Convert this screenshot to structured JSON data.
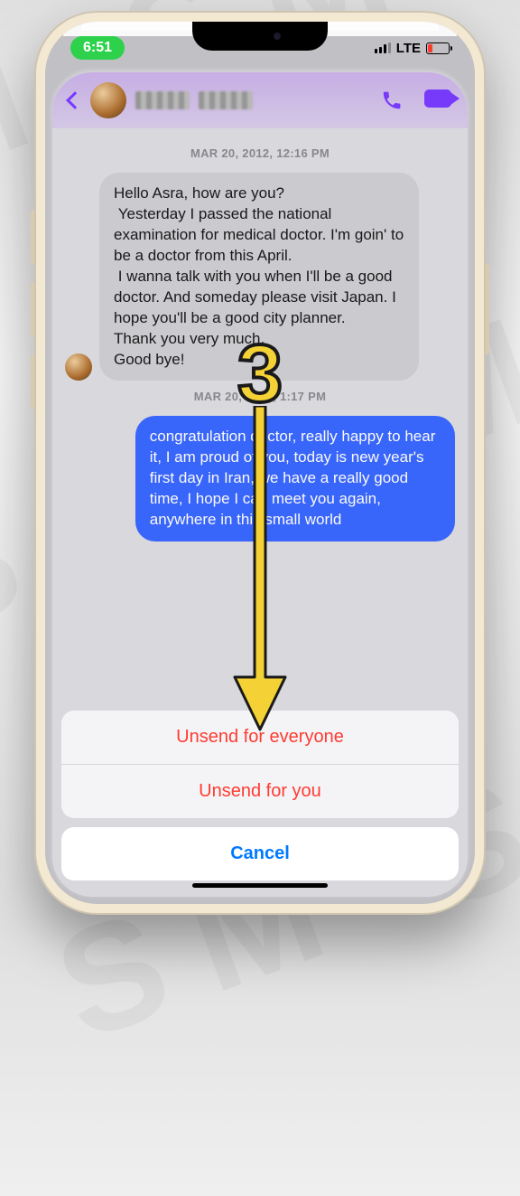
{
  "status": {
    "time": "6:51",
    "network": "LTE"
  },
  "header": {
    "contact_name_obscured": true
  },
  "timestamps": {
    "t1": "MAR 20, 2012, 12:16 PM",
    "t2": "MAR 20, 2012, 1:17 PM"
  },
  "messages": {
    "incoming": "Hello Asra, how are you?\n Yesterday I passed the national examination for medical doctor. I'm goin' to be a doctor from this April.\n I wanna talk with you when I'll be a good doctor. And someday please visit Japan. I hope you'll be a good city planner.\nThank you very much.\nGood bye!",
    "outgoing": "congratulation doctor, really happy to hear it, I am proud of you, today is new year's first day in Iran, we have a really good time, I hope I can meet you again, anywhere in this small world"
  },
  "action_sheet": {
    "unsend_everyone": "Unsend for everyone",
    "unsend_you": "Unsend for you",
    "cancel": "Cancel"
  },
  "annotation": {
    "step_number": "3"
  }
}
